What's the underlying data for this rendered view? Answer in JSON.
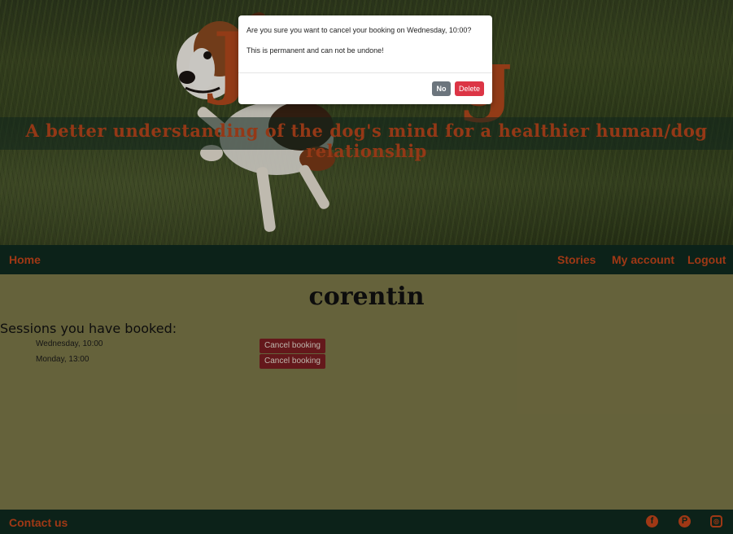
{
  "hero": {
    "logo_left": "J",
    "logo_right": "g",
    "tagline": "A better understanding of the dog's mind for a healthier human/dog relationship"
  },
  "nav": {
    "home": "Home",
    "stories": "Stories",
    "my_account": "My account",
    "logout": "Logout"
  },
  "main": {
    "username": "corentin",
    "sessions_heading": "Sessions you have booked:",
    "sessions": [
      {
        "when": "Wednesday, 10:00",
        "action": "Cancel booking"
      },
      {
        "when": "Monday, 13:00",
        "action": "Cancel booking"
      }
    ]
  },
  "footer": {
    "contact": "Contact us",
    "icons": [
      "facebook-icon",
      "pinterest-icon",
      "instagram-icon"
    ]
  },
  "modal": {
    "message": "Are you sure you want to cancel your booking on Wednesday, 10:00?",
    "warning": "This is permanent and can not be undone!",
    "no_label": "No",
    "delete_label": "Delete"
  },
  "colors": {
    "accent": "#c2451a",
    "nav_bg": "#0f2a1f",
    "page_bg": "#7c7848",
    "cancel_btn": "#7a1e22",
    "delete_btn": "#dc3545",
    "no_btn": "#6c757d"
  }
}
